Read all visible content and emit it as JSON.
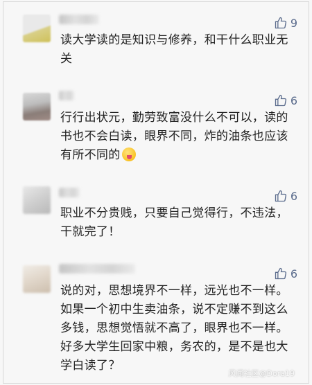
{
  "comments": [
    {
      "likes": "9",
      "text": "读大学读的是知识与修养，和干什么职业无关",
      "avatar": "blurred-avatar"
    },
    {
      "likes": "6",
      "text": "行行出状元，勤劳致富没什么不可以，读的书也不会白读，眼界不同，炸的油条也应该有所不同的",
      "emoji": "tongue-out-emoji",
      "avatar": "blurred-avatar"
    },
    {
      "likes": "6",
      "text": "职业不分贵贱，只要自己觉得行，不违法，干就完了！",
      "avatar": "blurred-avatar"
    },
    {
      "likes": "6",
      "text": "说的对，思想境界不一样，远光也不一样。如果一个初中生卖油条，说不定赚不到这么多钱，思想觉悟就不高了，眼界也不一样。好多大学生回家中粮，务农的，是不是也大学白读了？",
      "avatar": "blurred-avatar"
    }
  ],
  "watermark": "风闻社区@Dora19",
  "colors": {
    "like_blue": "#5a6b8c",
    "text": "#222222",
    "background": "#f7f7f7"
  }
}
